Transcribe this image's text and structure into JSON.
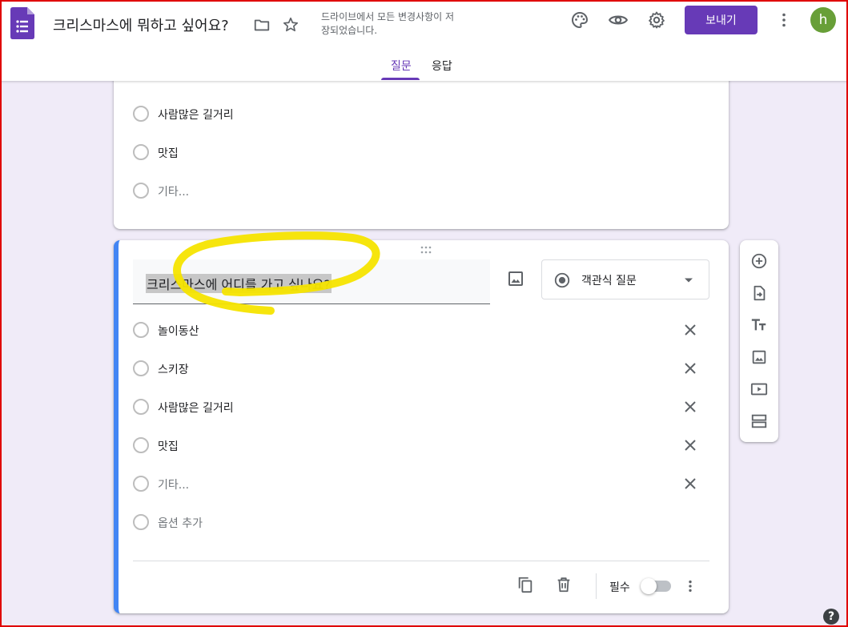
{
  "header": {
    "title": "크리스마스에 뭐하고 싶어요?",
    "save_status": "드라이브에서 모든 변경사항이 저장되었습니다.",
    "send_label": "보내기",
    "avatar_letter": "h",
    "icons": [
      "folder-icon",
      "star-icon",
      "palette-icon",
      "eye-icon",
      "gear-icon",
      "more-vert-icon"
    ]
  },
  "tabs": [
    {
      "label": "질문",
      "active": true
    },
    {
      "label": "응답",
      "active": false
    }
  ],
  "prev_question": {
    "options": [
      "사람많은 길거리",
      "맛집",
      "기타..."
    ]
  },
  "active_question": {
    "title": "크리스마스에 어디를 가고 싶나요?",
    "type_label": "객관식 질문",
    "options": [
      "놀이동산",
      "스키장",
      "사람많은 길거리",
      "맛집",
      "기타..."
    ],
    "add_option": "옵션 추가",
    "required_label": "필수",
    "required": false
  },
  "side_toolbar": [
    "add-question-icon",
    "import-question-icon",
    "add-title-icon",
    "add-image-icon",
    "add-video-icon",
    "add-section-icon"
  ],
  "help_label": "?",
  "colors": {
    "accent": "#673ab7",
    "active_border": "#4285f4",
    "highlight": "#f5e400",
    "background": "#f0ebf8"
  }
}
